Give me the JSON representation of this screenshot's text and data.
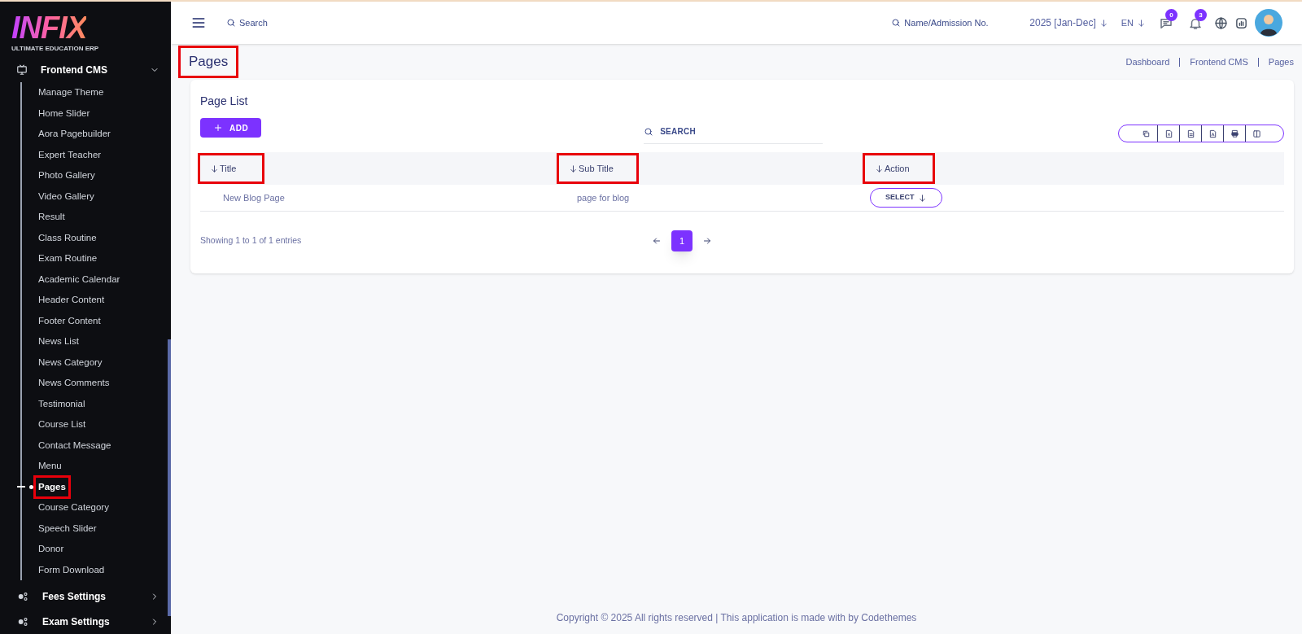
{
  "logo": {
    "name": "INFIX",
    "tagline": "ULTIMATE EDUCATION ERP"
  },
  "sidebar": {
    "items": [
      {
        "label": "Frontend CMS",
        "kind": "monitor",
        "expanded": true,
        "children": [
          {
            "label": "Manage Theme",
            "selected": false,
            "highlighted": false
          },
          {
            "label": "Home Slider",
            "selected": false,
            "highlighted": false
          },
          {
            "label": "Aora Pagebuilder",
            "selected": false,
            "highlighted": false
          },
          {
            "label": "Expert Teacher",
            "selected": false,
            "highlighted": false
          },
          {
            "label": "Photo Gallery",
            "selected": false,
            "highlighted": false
          },
          {
            "label": "Video Gallery",
            "selected": false,
            "highlighted": false
          },
          {
            "label": "Result",
            "selected": false,
            "highlighted": false
          },
          {
            "label": "Class Routine",
            "selected": false,
            "highlighted": false
          },
          {
            "label": "Exam Routine",
            "selected": false,
            "highlighted": false
          },
          {
            "label": "Academic Calendar",
            "selected": false,
            "highlighted": false
          },
          {
            "label": "Header Content",
            "selected": false,
            "highlighted": false
          },
          {
            "label": "Footer Content",
            "selected": false,
            "highlighted": false
          },
          {
            "label": "News List",
            "selected": false,
            "highlighted": false
          },
          {
            "label": "News Category",
            "selected": false,
            "highlighted": false
          },
          {
            "label": "News Comments",
            "selected": false,
            "highlighted": false
          },
          {
            "label": "Testimonial",
            "selected": false,
            "highlighted": false
          },
          {
            "label": "Course List",
            "selected": false,
            "highlighted": false
          },
          {
            "label": "Contact Message",
            "selected": false,
            "highlighted": false
          },
          {
            "label": "Menu",
            "selected": false,
            "highlighted": false
          },
          {
            "label": "Pages",
            "selected": true,
            "highlighted": true
          },
          {
            "label": "Course Category",
            "selected": false,
            "highlighted": false
          },
          {
            "label": "Speech Slider",
            "selected": false,
            "highlighted": false
          },
          {
            "label": "Donor",
            "selected": false,
            "highlighted": false
          },
          {
            "label": "Form Download",
            "selected": false,
            "highlighted": false
          }
        ]
      },
      {
        "label": "Fees Settings",
        "kind": "gears",
        "expanded": false
      },
      {
        "label": "Exam Settings",
        "kind": "gears",
        "expanded": false
      }
    ]
  },
  "topbar": {
    "search_placeholder": "Search",
    "student_search_placeholder": "Name/Admission No.",
    "session": "2025 [Jan-Dec]",
    "language": "EN",
    "messages_count": "0",
    "notifications_count": "3"
  },
  "page": {
    "title": "Pages",
    "title_highlighted": true,
    "breadcrumb": [
      "Dashboard",
      "Frontend CMS",
      "Pages"
    ]
  },
  "card": {
    "title": "Page List",
    "add_button": "ADD",
    "search_placeholder": "SEARCH",
    "export_buttons": [
      {
        "kind": "copy"
      },
      {
        "kind": "excel"
      },
      {
        "kind": "csv"
      },
      {
        "kind": "pdf"
      },
      {
        "kind": "print"
      },
      {
        "kind": "columns"
      }
    ],
    "table": {
      "columns": [
        {
          "label": "Title",
          "highlighted": true
        },
        {
          "label": "Sub Title",
          "highlighted": true
        },
        {
          "label": "Action",
          "highlighted": true
        }
      ],
      "rows": [
        {
          "title": "New Blog Page",
          "sub_title": "page for blog",
          "action": "SELECT"
        }
      ]
    },
    "entries": "Showing 1 to 1 of 1 entries",
    "pages": [
      {
        "label": "1",
        "selected": true
      }
    ]
  },
  "footer": "Copyright © 2025 All rights reserved | This application is made with by Codethemes"
}
